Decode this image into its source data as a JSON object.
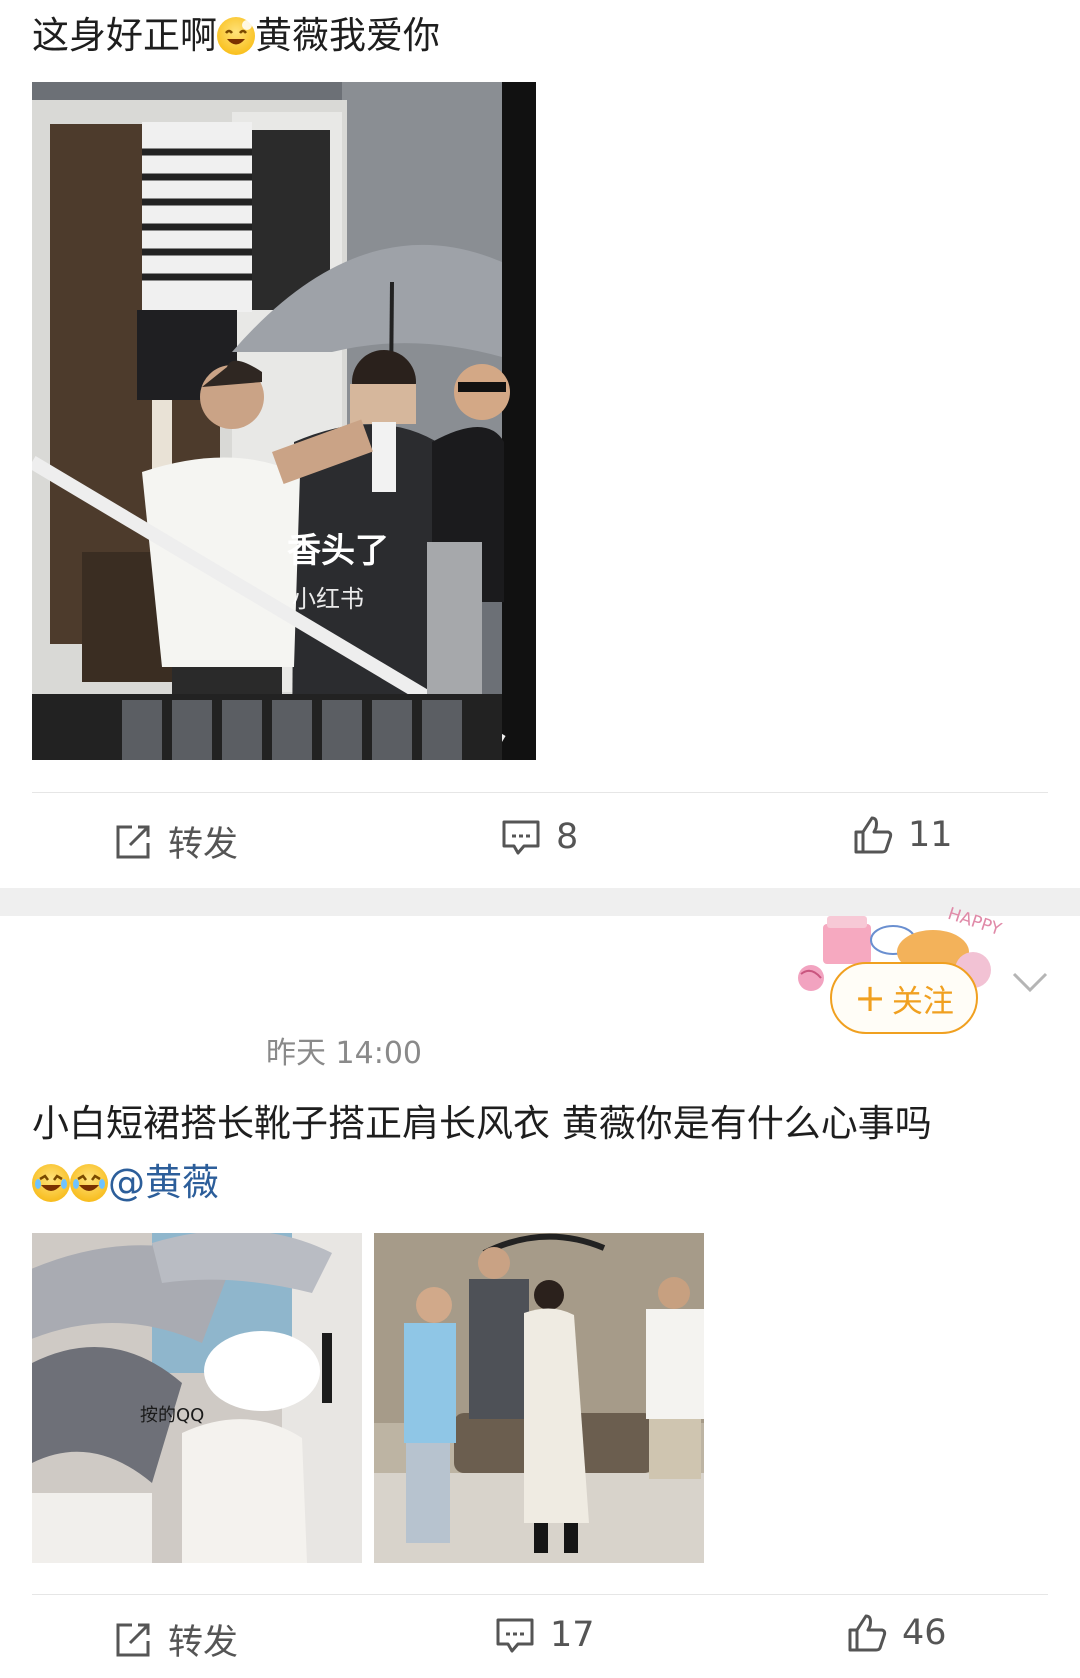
{
  "post1": {
    "text_part1": "这身好正啊",
    "text_part2": "黄薇我爱你",
    "image": {
      "overlay_caption": "香头了",
      "watermark": "小红书"
    },
    "actions": {
      "repost_label": "转发",
      "comment_count": "8",
      "like_count": "11"
    }
  },
  "post2": {
    "timestamp": "昨天 14:00",
    "follow_label": "关注",
    "follow_plus": "+",
    "decor_text": "HAPPY",
    "text_line1": "小白短裙搭长靴子搭正肩长风衣 黄薇你是有什么心事吗",
    "mention": "@黄薇",
    "image1_sticker_text": "按的QQ",
    "actions": {
      "repost_label": "转发",
      "comment_count": "17",
      "like_count": "46"
    }
  },
  "colors": {
    "accent_orange": "#f0a020",
    "mention_blue": "#2c5e9a",
    "divider": "#e6e6e6",
    "band": "#efefef",
    "muted_text": "#8a8a8a"
  },
  "icons": [
    "smile-emoji-icon",
    "repost-icon",
    "comment-icon",
    "like-icon",
    "laugh-emoji-icon",
    "chevron-down-icon",
    "plus-icon"
  ]
}
